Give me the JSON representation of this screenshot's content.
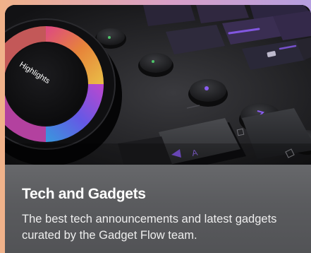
{
  "card": {
    "title": "Tech and Gadgets",
    "description": "The best tech announcements and latest gadgets curated by the Gadget Flow team.",
    "image": {
      "dial_label": "Highlights",
      "key_letter": "A",
      "icon": "keyboard-controller-image"
    }
  },
  "colors": {
    "page_gradient": [
      "#f0b289",
      "#d8a0c8",
      "#b59fe0"
    ],
    "caption_background": "#5a5b5e",
    "accent_purple": "#8a5cf0"
  }
}
